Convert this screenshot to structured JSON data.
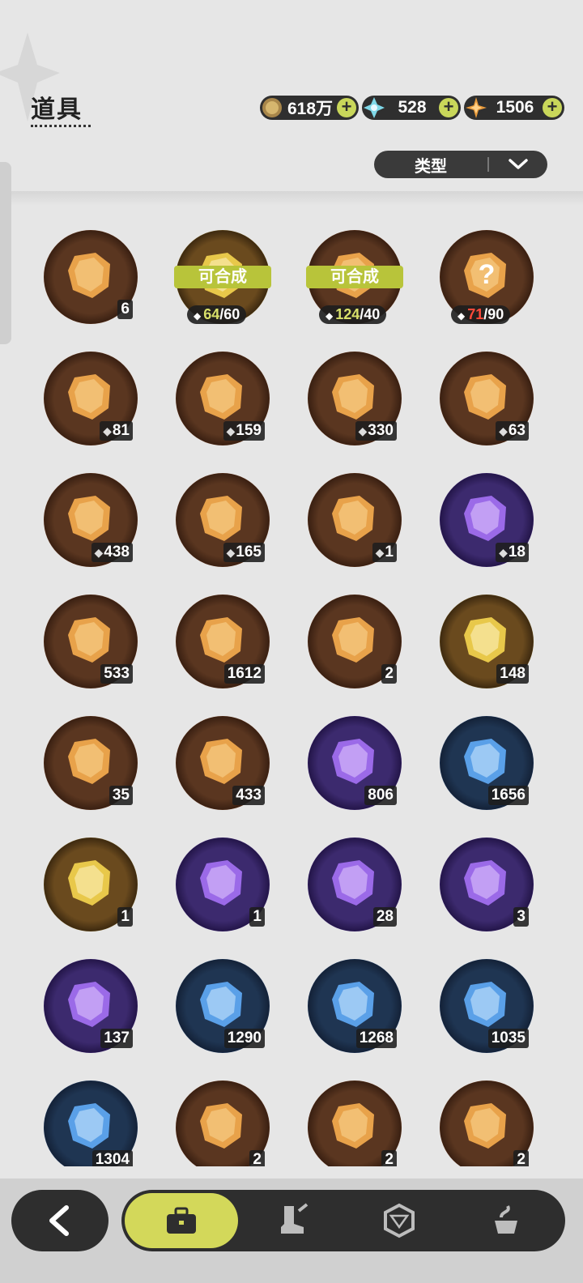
{
  "header": {
    "title": "道具"
  },
  "currencies": [
    {
      "name": "gold-coin",
      "value": "618万",
      "color": "#c9a45a"
    },
    {
      "name": "crystal",
      "value": "528",
      "color": "#7fd8e8"
    },
    {
      "name": "star-shard",
      "value": "1506",
      "color": "#e89a3a"
    }
  ],
  "filter": {
    "label": "类型"
  },
  "synth_label": "可合成",
  "items": [
    {
      "tier": "orange",
      "icon": "purple-crystal-icon",
      "count": "6"
    },
    {
      "tier": "gold",
      "icon": "puzzle-fragment-icon",
      "synth": true,
      "have": "64",
      "need": "/60",
      "ok": true
    },
    {
      "tier": "orange",
      "icon": "puzzle-fragment-icon",
      "synth": true,
      "have": "124",
      "need": "/40",
      "ok": true
    },
    {
      "tier": "orange",
      "icon": "mystery-puzzle-icon",
      "have": "71",
      "need": "/90",
      "ok": false
    },
    {
      "tier": "orange",
      "icon": "white-mouse-puzzle-icon",
      "count": "81",
      "puzzle": true
    },
    {
      "tier": "orange",
      "icon": "bear-puzzle-icon",
      "count": "159",
      "puzzle": true
    },
    {
      "tier": "orange",
      "icon": "knight-puzzle-icon",
      "count": "330",
      "puzzle": true
    },
    {
      "tier": "orange",
      "icon": "white-cat-puzzle-icon",
      "count": "63",
      "puzzle": true
    },
    {
      "tier": "orange",
      "icon": "dark-bear-puzzle-icon",
      "count": "438",
      "puzzle": true
    },
    {
      "tier": "orange",
      "icon": "lavender-cat-puzzle-icon",
      "count": "165",
      "puzzle": true
    },
    {
      "tier": "orange",
      "icon": "tiger-puzzle-icon",
      "count": "1",
      "puzzle": true
    },
    {
      "tier": "purple",
      "icon": "purple-cat-puzzle-icon",
      "count": "18",
      "puzzle": true
    },
    {
      "tier": "orange",
      "icon": "pink-star-crystal-icon",
      "count": "533"
    },
    {
      "tier": "orange",
      "icon": "blue-star-crystal-icon",
      "count": "1612"
    },
    {
      "tier": "orange",
      "icon": "paw-medal-icon",
      "count": "2"
    },
    {
      "tier": "gold",
      "icon": "gold-card-icon",
      "count": "148"
    },
    {
      "tier": "orange",
      "icon": "rainbow-card-icon",
      "count": "35"
    },
    {
      "tier": "orange",
      "icon": "orange-card-icon",
      "count": "433"
    },
    {
      "tier": "purple",
      "icon": "purple-card-icon",
      "count": "806"
    },
    {
      "tier": "blue",
      "icon": "blue-card-icon",
      "count": "1656"
    },
    {
      "tier": "gold",
      "icon": "birthday-cake-icon",
      "count": "1"
    },
    {
      "tier": "purple",
      "icon": "gift-box-icon",
      "count": "1"
    },
    {
      "tier": "purple",
      "icon": "gold-pouch-icon",
      "count": "28"
    },
    {
      "tier": "purple",
      "icon": "scroll-icon",
      "count": "3"
    },
    {
      "tier": "purple",
      "icon": "apple-icon",
      "count": "137"
    },
    {
      "tier": "blue",
      "icon": "shovel-icon",
      "count": "1290"
    },
    {
      "tier": "blue",
      "icon": "boxing-glove-icon",
      "count": "1268"
    },
    {
      "tier": "blue",
      "icon": "pickaxe-icon",
      "count": "1035"
    },
    {
      "tier": "blue",
      "icon": "hammer-icon",
      "count": "1304"
    },
    {
      "tier": "orange",
      "icon": "green-cloud-icon",
      "count": "2"
    },
    {
      "tier": "orange",
      "icon": "spiked-ball-icon",
      "count": "2"
    },
    {
      "tier": "orange",
      "icon": "drill-icon",
      "count": "2"
    }
  ],
  "nav": {
    "back": "back-arrow-icon",
    "tabs": [
      {
        "icon": "briefcase-icon",
        "active": true
      },
      {
        "icon": "boot-sword-icon",
        "active": false
      },
      {
        "icon": "hexagon-icon",
        "active": false
      },
      {
        "icon": "cup-icon",
        "active": false
      }
    ]
  }
}
